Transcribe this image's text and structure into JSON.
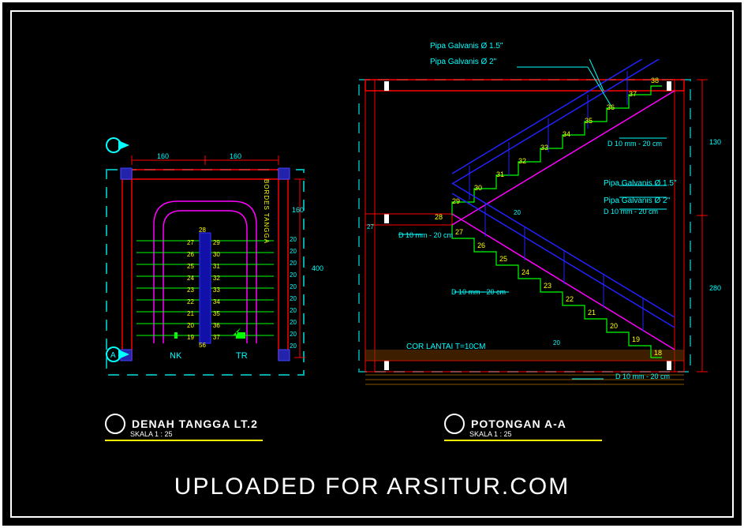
{
  "plan": {
    "title": "DENAH TANGGA LT.2",
    "scale": "SKALA 1 : 25",
    "dim_160a": "160",
    "dim_160b": "160",
    "dim_400": "400",
    "dim_160c": "160",
    "dim_20": "20",
    "top_label_28": "28",
    "bottom_label_56": "56",
    "label_nk": "NK",
    "label_tr": "TR",
    "bordes": "BORDES TANGGA",
    "steps_left": [
      "27",
      "26",
      "25",
      "24",
      "23",
      "22",
      "21",
      "20",
      "19"
    ],
    "steps_right": [
      "29",
      "30",
      "31",
      "32",
      "33",
      "34",
      "35",
      "36",
      "37"
    ],
    "dims_right": [
      "20",
      "20",
      "20",
      "20",
      "20",
      "20",
      "20",
      "20",
      "20",
      "20"
    ]
  },
  "section": {
    "title": "POTONGAN A-A",
    "scale": "SKALA 1 : 25",
    "pipe15": "Pipa Galvanis Ø 1.5\"",
    "pipe2": "Pipa Galvanis Ø 2\"",
    "rebar": "D 10 mm - 20 cm",
    "floor": "COR LANTAI T=10CM",
    "dim_130": "130",
    "dim_280": "280",
    "dim_20": "20",
    "dim_27": "27",
    "steps_upper": [
      "38",
      "37",
      "36",
      "35",
      "34",
      "33",
      "32",
      "31",
      "30",
      "29"
    ],
    "steps_mid": "28",
    "steps_lower": [
      "27",
      "26",
      "25",
      "24",
      "23",
      "22",
      "21",
      "20",
      "19",
      "18"
    ]
  },
  "watermark": "UPLOADED FOR ARSITUR.COM"
}
